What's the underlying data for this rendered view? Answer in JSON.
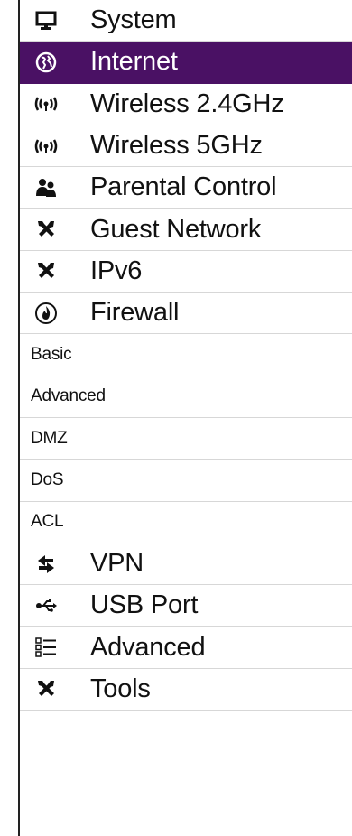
{
  "menu": {
    "items": [
      {
        "id": "system",
        "label": "System",
        "icon": "monitor-icon",
        "type": "main"
      },
      {
        "id": "internet",
        "label": "Internet",
        "icon": "globe-icon",
        "type": "main",
        "active": true
      },
      {
        "id": "wireless-24",
        "label": "Wireless 2.4GHz",
        "icon": "wireless-icon",
        "type": "main"
      },
      {
        "id": "wireless-5",
        "label": "Wireless 5GHz",
        "icon": "wireless-icon",
        "type": "main"
      },
      {
        "id": "parental",
        "label": "Parental Control",
        "icon": "users-icon",
        "type": "main"
      },
      {
        "id": "guest",
        "label": "Guest Network",
        "icon": "tools-icon",
        "type": "main"
      },
      {
        "id": "ipv6",
        "label": "IPv6",
        "icon": "tools-icon",
        "type": "main"
      },
      {
        "id": "firewall",
        "label": "Firewall",
        "icon": "firewall-icon",
        "type": "main"
      },
      {
        "id": "basic",
        "label": "Basic",
        "type": "sub"
      },
      {
        "id": "advanced-sub",
        "label": "Advanced",
        "type": "sub"
      },
      {
        "id": "dmz",
        "label": "DMZ",
        "type": "sub"
      },
      {
        "id": "dos",
        "label": "DoS",
        "type": "sub"
      },
      {
        "id": "acl",
        "label": "ACL",
        "type": "sub"
      },
      {
        "id": "vpn",
        "label": "VPN",
        "icon": "vpn-icon",
        "type": "main"
      },
      {
        "id": "usb",
        "label": "USB Port",
        "icon": "usb-icon",
        "type": "main"
      },
      {
        "id": "advanced",
        "label": "Advanced",
        "icon": "list-icon",
        "type": "main"
      },
      {
        "id": "tools",
        "label": "Tools",
        "icon": "tools-icon",
        "type": "main"
      }
    ]
  },
  "colors": {
    "active_bg": "#4a1164",
    "active_text": "#ffffff",
    "divider": "#d7d7d7"
  }
}
